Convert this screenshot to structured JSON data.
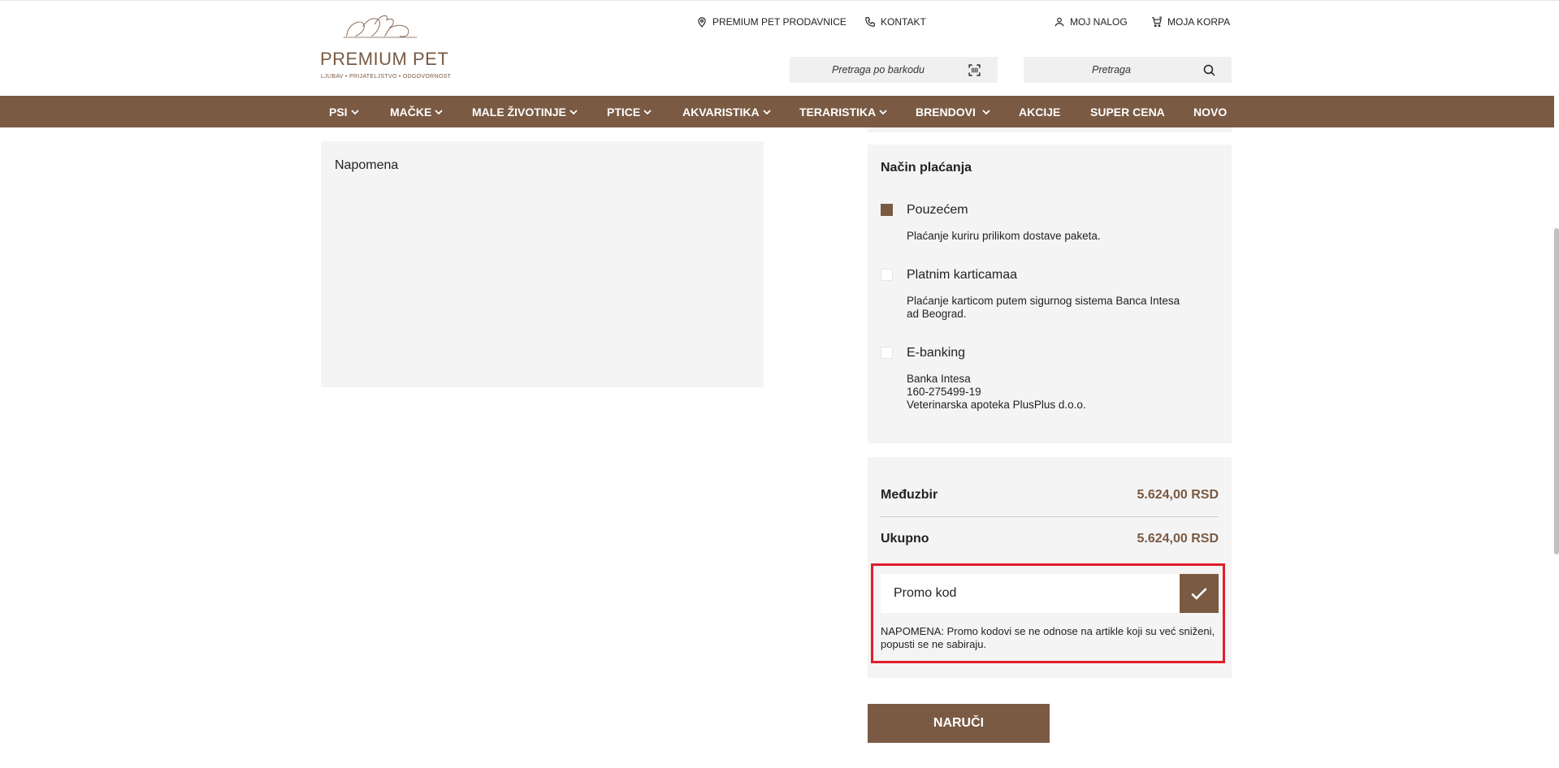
{
  "header": {
    "logo_text": "PREMIUM PET",
    "logo_tagline": "LJUBAV • PRIJATELJSTVO • ODGOVORNOST",
    "links": {
      "stores": "PREMIUM PET PRODAVNICE",
      "contact": "KONTAKT",
      "account": "MOJ NALOG",
      "cart": "MOJA KORPA"
    },
    "barcode_search_placeholder": "Pretraga po barkodu",
    "search_placeholder": "Pretraga"
  },
  "nav": {
    "items": [
      {
        "label": "PSI",
        "dropdown": true
      },
      {
        "label": "MAČKE",
        "dropdown": true
      },
      {
        "label": "MALE ŽIVOTINJE",
        "dropdown": true
      },
      {
        "label": "PTICE",
        "dropdown": true
      },
      {
        "label": "AKVARISTIKA",
        "dropdown": true
      },
      {
        "label": "TERARISTIKA",
        "dropdown": true
      },
      {
        "label": "BRENDOVI",
        "dropdown": true
      },
      {
        "label": "AKCIJE",
        "dropdown": false
      },
      {
        "label": "SUPER CENA",
        "dropdown": false
      },
      {
        "label": "NOVO",
        "dropdown": false
      }
    ]
  },
  "note": {
    "label": "Napomena"
  },
  "payment": {
    "title": "Način plaćanja",
    "options": [
      {
        "label": "Pouzećem",
        "checked": true,
        "desc_lines": [
          "Plaćanje kuriru prilikom dostave paketa."
        ]
      },
      {
        "label": "Platnim karticamaa",
        "checked": false,
        "desc_lines": [
          "Plaćanje karticom putem sigurnog sistema Banca Intesa",
          "ad Beograd."
        ]
      },
      {
        "label": "E-banking",
        "checked": false,
        "desc_lines": [
          "Banka Intesa",
          "160-275499-19",
          "Veterinarska apoteka PlusPlus d.o.o."
        ]
      }
    ]
  },
  "summary": {
    "subtotal_label": "Međuzbir",
    "subtotal_value": "5.624,00 RSD",
    "total_label": "Ukupno",
    "total_value": "5.624,00 RSD"
  },
  "promo": {
    "placeholder": "Promo kod",
    "note": "NAPOMENA: Promo kodovi se ne odnose na artikle koji su već sniženi, popusti se ne sabiraju."
  },
  "order_button": "NARUČI",
  "colors": {
    "brand": "#7a5a43",
    "panel": "#f4f4f4",
    "highlight": "#e21d2b"
  },
  "icons": {
    "stores": "location-pin-icon",
    "contact": "phone-icon",
    "account": "user-icon",
    "cart": "cart-icon",
    "barcode": "barcode-scan-icon",
    "search": "search-icon",
    "promo_apply": "checkmark-icon"
  }
}
